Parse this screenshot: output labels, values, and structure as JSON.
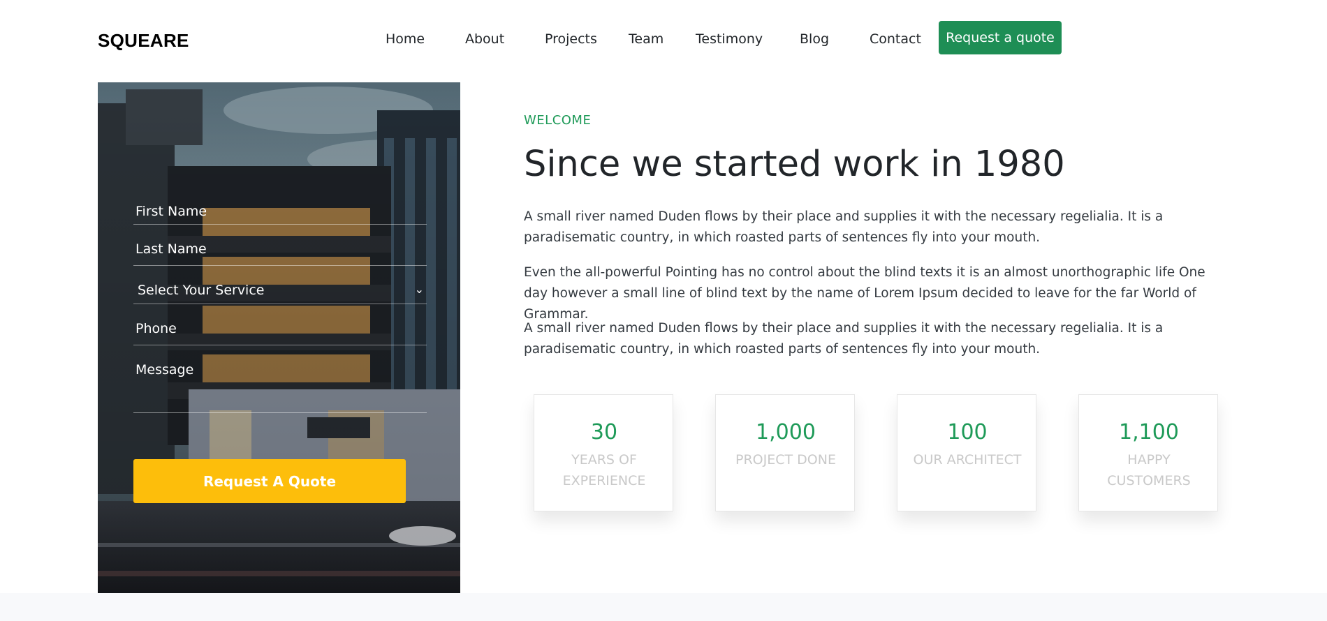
{
  "brand": "SQUEARE",
  "nav": {
    "items": [
      {
        "label": "Home"
      },
      {
        "label": "About"
      },
      {
        "label": "Projects"
      },
      {
        "label": "Team"
      },
      {
        "label": "Testimony"
      },
      {
        "label": "Blog"
      },
      {
        "label": "Contact"
      }
    ],
    "cta_label": "Request a quote"
  },
  "form": {
    "first_name": "First Name",
    "last_name": "Last Name",
    "service": "Select Your Service",
    "phone": "Phone",
    "message": "Message",
    "submit_label": "Request A Quote"
  },
  "about": {
    "eyebrow": "WELCOME",
    "title": "Since we started work in 1980",
    "paragraphs": [
      "A small river named Duden flows by their place and supplies it with the necessary regelialia. It is a paradisematic country, in which roasted parts of sentences fly into your mouth.",
      "Even the all-powerful Pointing has no control about the blind texts it is an almost unorthographic life One day however a small line of blind text by the name of Lorem Ipsum decided to leave for the far World of Grammar.",
      "A small river named Duden flows by their place and supplies it with the necessary regelialia. It is a paradisematic country, in which roasted parts of sentences fly into your mouth."
    ]
  },
  "stats": [
    {
      "value": "30",
      "label": "YEARS OF EXPERIENCE"
    },
    {
      "value": "1,000",
      "label": "PROJECT DONE"
    },
    {
      "value": "100",
      "label": "OUR ARCHITECT"
    },
    {
      "value": "1,100",
      "label": "HAPPY CUSTOMERS"
    }
  ],
  "colors": {
    "accent_green": "#1e8e55",
    "accent_yellow": "#fdbe0b",
    "stat_label": "#c9c9c9"
  }
}
